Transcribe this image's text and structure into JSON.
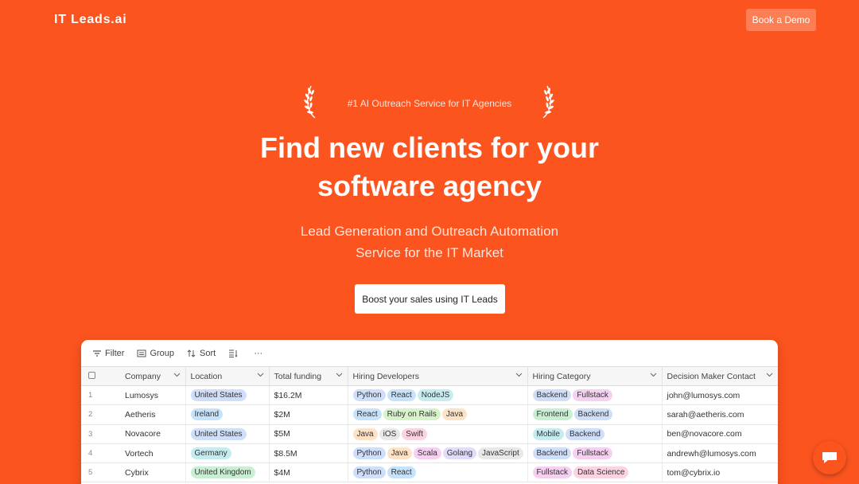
{
  "header": {
    "logo": "IT Leads.ai",
    "demo_label": "Book a Demo"
  },
  "hero": {
    "badge": "#1 AI Outreach Service for IT Agencies",
    "title_line1": "Find new clients for your",
    "title_line2": "software agency",
    "subtitle_line1": "Lead Generation and Outreach Automation",
    "subtitle_line2": "Service for the IT Market",
    "cta_label": "Boost your sales using IT Leads"
  },
  "toolbar": {
    "filter": "Filter",
    "group": "Group",
    "sort": "Sort",
    "more": "···"
  },
  "table": {
    "columns": [
      "Company",
      "Location",
      "Total funding",
      "Hiring Developers",
      "Hiring Category",
      "Decision Maker Contact"
    ],
    "rows": [
      {
        "num": "1",
        "company": "Lumosys",
        "location": "United States",
        "loc_color": "blue",
        "funding": "$16.2M",
        "devs": [
          {
            "t": "Python",
            "c": "blue"
          },
          {
            "t": "React",
            "c": "lightblue"
          },
          {
            "t": "NodeJS",
            "c": "teal"
          }
        ],
        "cats": [
          {
            "t": "Backend",
            "c": "blue"
          },
          {
            "t": "Fullstack",
            "c": "mag"
          }
        ],
        "contact": "john@lumosys.com"
      },
      {
        "num": "2",
        "company": "Aetheris",
        "location": "Ireland",
        "loc_color": "lightblue",
        "funding": "$2M",
        "devs": [
          {
            "t": "React",
            "c": "lightblue"
          },
          {
            "t": "Ruby on Rails",
            "c": "lightgreen"
          },
          {
            "t": "Java",
            "c": "orange"
          }
        ],
        "cats": [
          {
            "t": "Frontend",
            "c": "green"
          },
          {
            "t": "Backend",
            "c": "blue"
          }
        ],
        "contact": "sarah@aetheris.com"
      },
      {
        "num": "3",
        "company": "Novacore",
        "location": "United States",
        "loc_color": "blue",
        "funding": "$5M",
        "devs": [
          {
            "t": "Java",
            "c": "orange"
          },
          {
            "t": "iOS",
            "c": "gray"
          },
          {
            "t": "Swift",
            "c": "pink"
          }
        ],
        "cats": [
          {
            "t": "Mobile",
            "c": "teal"
          },
          {
            "t": "Backend",
            "c": "blue"
          }
        ],
        "contact": "ben@novacore.com"
      },
      {
        "num": "4",
        "company": "Vortech",
        "location": "Germany",
        "loc_color": "teal",
        "funding": "$8.5M",
        "devs": [
          {
            "t": "Python",
            "c": "blue"
          },
          {
            "t": "Java",
            "c": "orange"
          },
          {
            "t": "Scala",
            "c": "mag"
          },
          {
            "t": "Golang",
            "c": "purple"
          },
          {
            "t": "JavaScript",
            "c": "gray"
          }
        ],
        "cats": [
          {
            "t": "Backend",
            "c": "blue"
          },
          {
            "t": "Fullstack",
            "c": "mag"
          }
        ],
        "contact": "andrewh@lumosys.com"
      },
      {
        "num": "5",
        "company": "Cybrix",
        "location": "United Kingdom",
        "loc_color": "green",
        "funding": "$4M",
        "devs": [
          {
            "t": "Python",
            "c": "blue"
          },
          {
            "t": "React",
            "c": "lightblue"
          }
        ],
        "cats": [
          {
            "t": "Fullstack",
            "c": "mag"
          },
          {
            "t": "Data Science",
            "c": "pink"
          }
        ],
        "contact": "tom@cybrix.io"
      }
    ]
  },
  "colors": {
    "brand": "#fb541f",
    "demo_button": "#fd7d54"
  },
  "icons": [
    "laurel-icon",
    "filter-icon",
    "group-icon",
    "sort-icon",
    "row-height-icon",
    "chevron-down-icon",
    "chat-icon"
  ]
}
